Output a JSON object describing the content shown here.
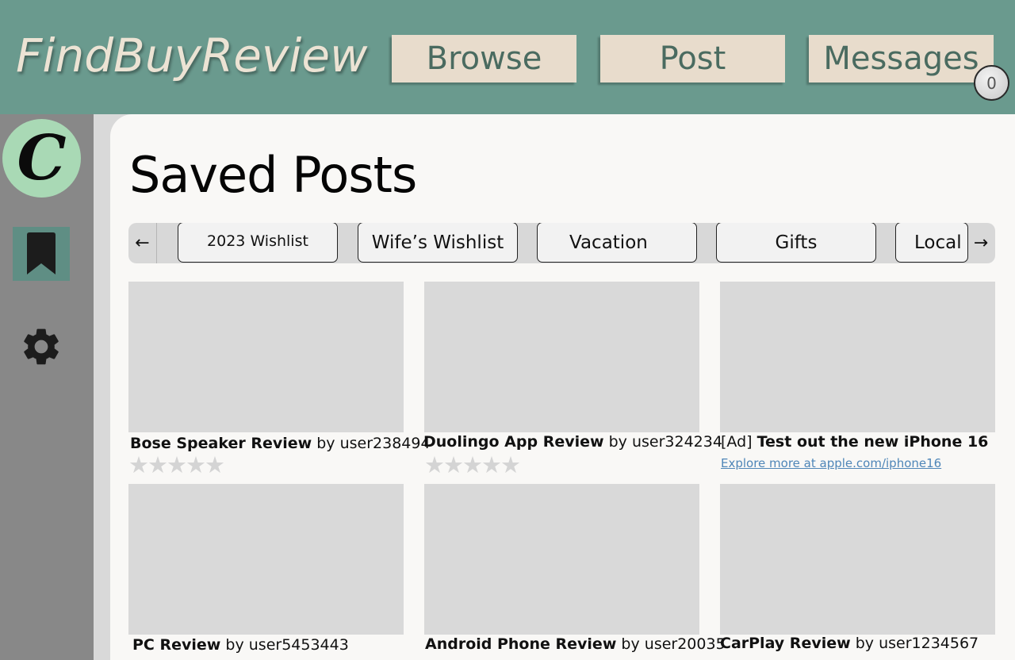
{
  "header": {
    "logo": "FindBuyReview",
    "nav": [
      {
        "label": "Browse"
      },
      {
        "label": "Post"
      },
      {
        "label": "Messages"
      }
    ],
    "messages_badge": "0"
  },
  "sidebar": {
    "avatar_letter": "C",
    "items": [
      {
        "icon": "bookmark-icon",
        "active": true
      },
      {
        "icon": "gear-icon",
        "active": false
      }
    ]
  },
  "main": {
    "title": "Saved Posts",
    "tabs": [
      {
        "label": "2023 Wishlist"
      },
      {
        "label": "Wife’s Wishlist"
      },
      {
        "label": "Vacation"
      },
      {
        "label": "Gifts"
      },
      {
        "label": "Local"
      }
    ],
    "arrows": {
      "prev": "←",
      "next": "→"
    },
    "posts": [
      {
        "title": "Bose Speaker Review",
        "by": "by",
        "user": "user238494",
        "rating": 0,
        "stars": "★★★★★"
      },
      {
        "title": "Duolingo App Review",
        "by": "by",
        "user": "user324234",
        "rating": 0,
        "stars": "★★★★★"
      },
      {
        "ad_tag": "[Ad]",
        "title": "Test out the new iPhone 16",
        "link": "Explore more at apple.com/iphone16"
      },
      {
        "title": "PC Review",
        "by": "by",
        "user": "user5453443"
      },
      {
        "title": "Android Phone Review",
        "by": "by",
        "user": "user20035"
      },
      {
        "title": "CarPlay Review",
        "by": "by",
        "user": "user1234567"
      }
    ]
  },
  "colors": {
    "header_bg": "#6a9a8e",
    "nav_button_bg": "#e8dccc",
    "nav_text": "#4a6b60",
    "sidebar_bg": "#888888",
    "avatar_bg": "#a9d9b5",
    "active_item_bg": "#5f8e84",
    "panel_bg": "#f9f8f6",
    "placeholder": "#d9d9d9",
    "link": "#4f86b8"
  }
}
